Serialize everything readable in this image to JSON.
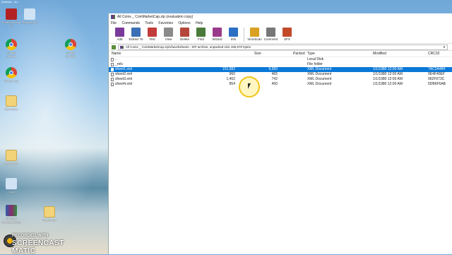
{
  "window": {
    "title": "All Coins _ CoinMarketCap.zip (evaluation copy)",
    "menu": [
      "File",
      "Commands",
      "Tools",
      "Favorites",
      "Options",
      "Help"
    ],
    "toolbar": [
      {
        "label": "Add",
        "icon": "add-icon",
        "color": "#7a3a9a"
      },
      {
        "label": "Extract To",
        "icon": "extract-icon",
        "color": "#3a6fb5"
      },
      {
        "label": "Test",
        "icon": "test-icon",
        "color": "#c23b3b"
      },
      {
        "label": "View",
        "icon": "view-icon",
        "color": "#8a8a8a"
      },
      {
        "label": "Delete",
        "icon": "delete-icon",
        "color": "#b5473a"
      },
      {
        "label": "Find",
        "icon": "find-icon",
        "color": "#4a7a3a"
      },
      {
        "label": "Wizard",
        "icon": "wizard-icon",
        "color": "#9a3a8a"
      },
      {
        "label": "Info",
        "icon": "info-icon",
        "color": "#2b6fc4"
      },
      {
        "label": "VirusScan",
        "icon": "virusscan-icon",
        "color": "#d9a021"
      },
      {
        "label": "Comment",
        "icon": "comment-icon",
        "color": "#777777"
      },
      {
        "label": "SFX",
        "icon": "sfx-icon",
        "color": "#c24a2b"
      }
    ],
    "address": "All Coins _ CoinMarketCap.zip\\xl\\worksheets - ZIP archive, unpacked size 155,570 bytes",
    "columns": {
      "name": "Name",
      "size": "Size",
      "packed": "Packed",
      "type": "Type",
      "modified": "Modified",
      "crc": "CRC32"
    },
    "rows": [
      {
        "name": "..",
        "size": "",
        "packed": "",
        "type": "Local Disk",
        "modified": "",
        "crc": "",
        "selected": false
      },
      {
        "name": "_rels",
        "size": "",
        "packed": "",
        "type": "File folder",
        "modified": "",
        "crc": "",
        "selected": false
      },
      {
        "name": "sheet1.xml",
        "size": "151,982",
        "packed": "9,582",
        "type": "XML Document",
        "modified": "1/1/1980 12:00 AM",
        "crc": "7AC2A484",
        "selected": true
      },
      {
        "name": "sheet2.xml",
        "size": "960",
        "packed": "465",
        "type": "XML Document",
        "modified": "1/1/1980 12:00 AM",
        "crc": "0E4F40EF",
        "selected": false
      },
      {
        "name": "sheet3.xml",
        "size": "1,462",
        "packed": "742",
        "type": "XML Document",
        "modified": "1/1/1980 12:00 AM",
        "crc": "962F673C",
        "selected": false
      },
      {
        "name": "sheet4.xml",
        "size": "854",
        "packed": "450",
        "type": "XML Document",
        "modified": "1/1/1980 12:00 AM",
        "crc": "5DB6F6AB",
        "selected": false
      }
    ]
  },
  "desktop": {
    "top_caption": "Desktop - sh...",
    "icons": [
      {
        "label": "Adobe Acrobat DC",
        "kind": "pdf"
      },
      {
        "label": "Recycle Bin",
        "kind": "recycle"
      },
      {
        "label": "Google Chrome",
        "kind": "chrome"
      },
      {
        "label": "Google Chrome",
        "kind": "chrome"
      },
      {
        "label": "Chrome (2)",
        "kind": "chrome"
      },
      {
        "label": "New folder",
        "kind": "folder"
      },
      {
        "label": "New folder",
        "kind": "folder"
      },
      {
        "label": "e pdf",
        "kind": "recycle"
      },
      {
        "label": "All Coins CoinMarketCap",
        "kind": "rar"
      },
      {
        "label": "PaperForm",
        "kind": "folder"
      }
    ]
  },
  "watermark": {
    "top": "RECORDED WITH",
    "bottom": "SCREENCAST  MATIC"
  }
}
